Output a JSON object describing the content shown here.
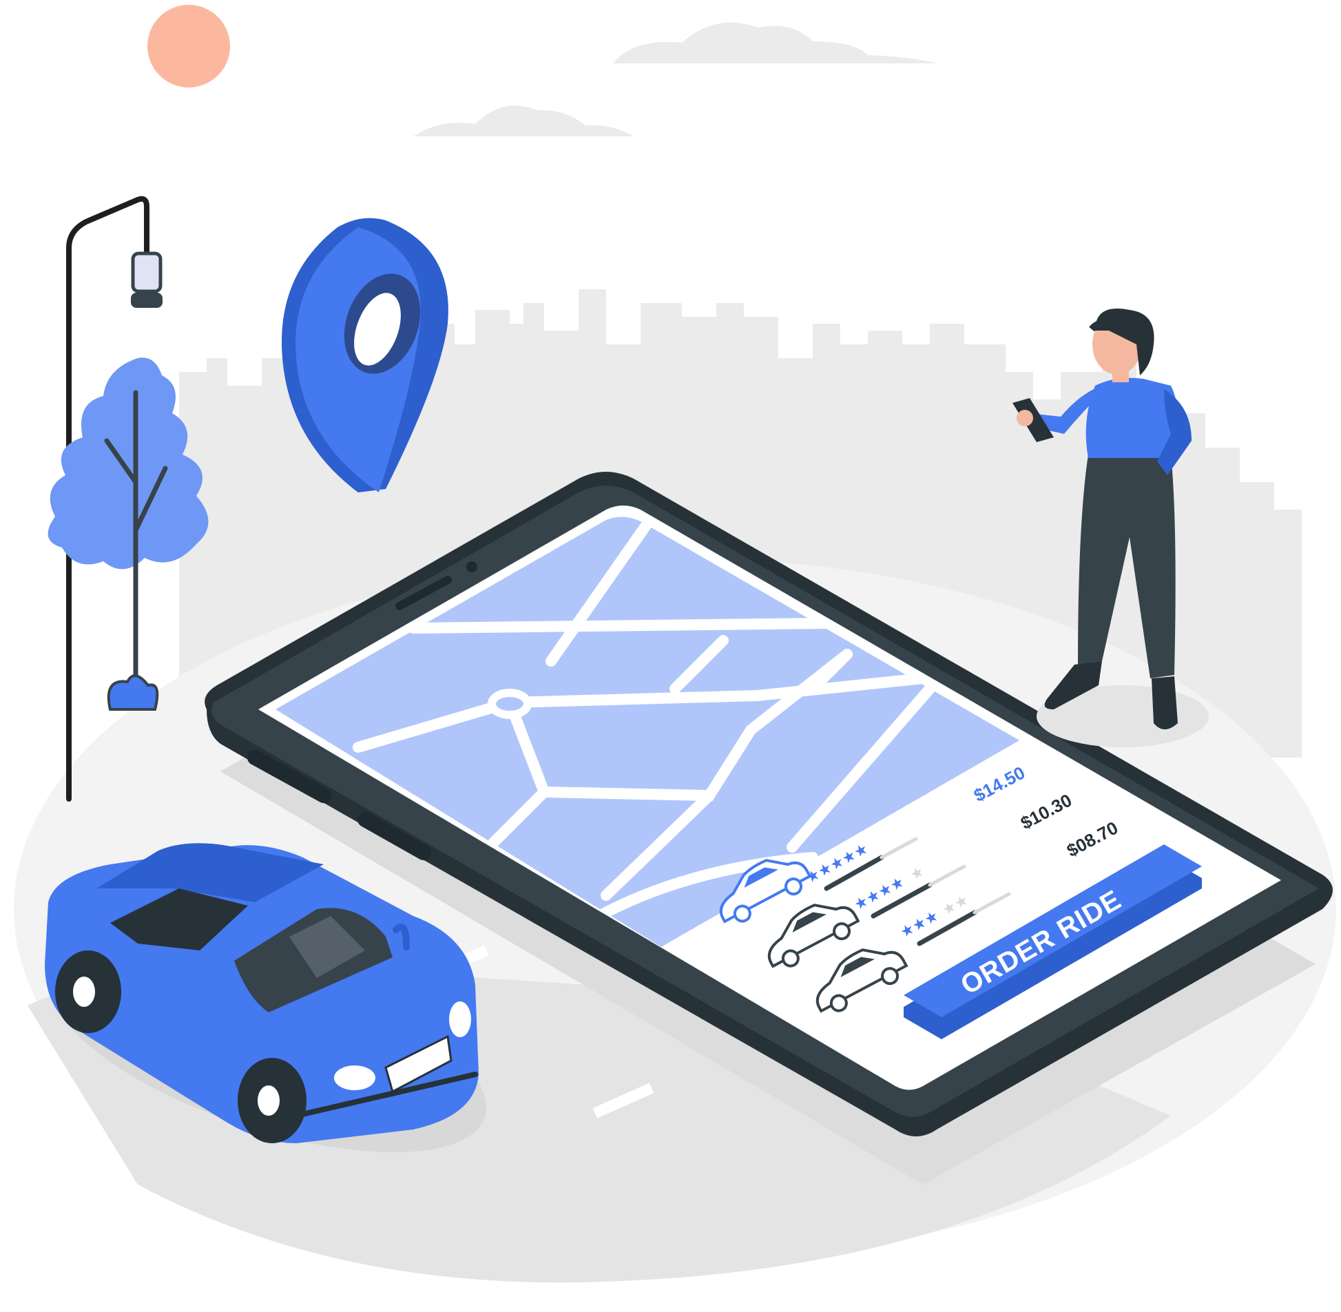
{
  "illustration": {
    "description_colors": {
      "accent": "#4479F0",
      "accent_light": "#B0C6FA",
      "accent_mid": "#6F97F5",
      "dark": "#37434A",
      "sun": "#FBB89F",
      "background_gray": "#EBEBEB"
    }
  },
  "app": {
    "ride_options": [
      {
        "price": "$14.50",
        "rating": 5,
        "icon": "car-icon",
        "selected": true
      },
      {
        "price": "$10.30",
        "rating": 4,
        "icon": "car-icon",
        "selected": false
      },
      {
        "price": "$08.70",
        "rating": 3,
        "icon": "car-icon",
        "selected": false
      }
    ],
    "order_button_label": "ORDER RIDE",
    "map_pin_icon": "location-pin-icon"
  }
}
